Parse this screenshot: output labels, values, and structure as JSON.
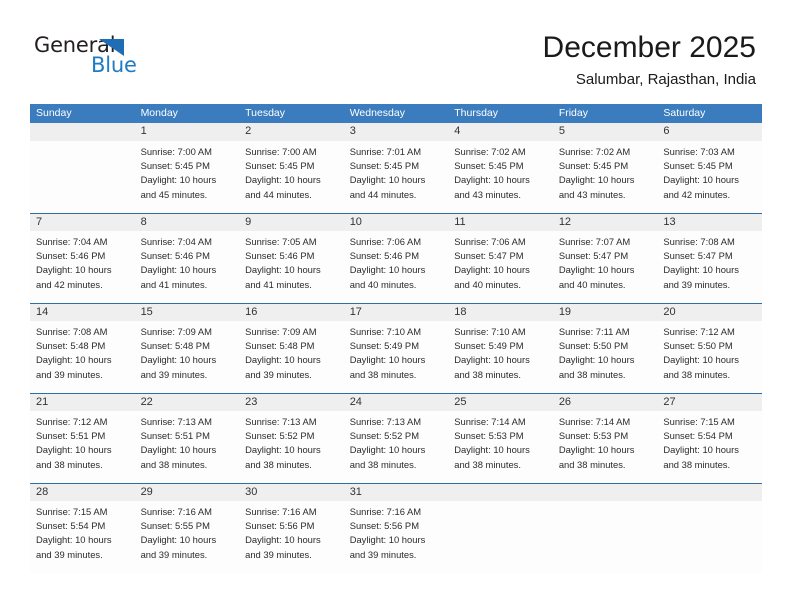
{
  "brand": {
    "name_part1": "General",
    "name_part2": "Blue",
    "triangle_icon": "triangle-icon",
    "accent_color": "#1f7cc4"
  },
  "header": {
    "title": "December 2025",
    "location": "Salumbar, Rajasthan, India"
  },
  "colors": {
    "header_blue": "#3a7cbe",
    "row_separator_blue": "#2e6da4",
    "daynum_band": "#efefef"
  },
  "calendar": {
    "weekday_headers": [
      "Sunday",
      "Monday",
      "Tuesday",
      "Wednesday",
      "Thursday",
      "Friday",
      "Saturday"
    ],
    "weeks": [
      [
        {
          "day": "",
          "sunrise": "",
          "sunset": "",
          "daylight_line1": "",
          "daylight_line2": ""
        },
        {
          "day": "1",
          "sunrise": "Sunrise: 7:00 AM",
          "sunset": "Sunset: 5:45 PM",
          "daylight_line1": "Daylight: 10 hours",
          "daylight_line2": "and 45 minutes."
        },
        {
          "day": "2",
          "sunrise": "Sunrise: 7:00 AM",
          "sunset": "Sunset: 5:45 PM",
          "daylight_line1": "Daylight: 10 hours",
          "daylight_line2": "and 44 minutes."
        },
        {
          "day": "3",
          "sunrise": "Sunrise: 7:01 AM",
          "sunset": "Sunset: 5:45 PM",
          "daylight_line1": "Daylight: 10 hours",
          "daylight_line2": "and 44 minutes."
        },
        {
          "day": "4",
          "sunrise": "Sunrise: 7:02 AM",
          "sunset": "Sunset: 5:45 PM",
          "daylight_line1": "Daylight: 10 hours",
          "daylight_line2": "and 43 minutes."
        },
        {
          "day": "5",
          "sunrise": "Sunrise: 7:02 AM",
          "sunset": "Sunset: 5:45 PM",
          "daylight_line1": "Daylight: 10 hours",
          "daylight_line2": "and 43 minutes."
        },
        {
          "day": "6",
          "sunrise": "Sunrise: 7:03 AM",
          "sunset": "Sunset: 5:45 PM",
          "daylight_line1": "Daylight: 10 hours",
          "daylight_line2": "and 42 minutes."
        }
      ],
      [
        {
          "day": "7",
          "sunrise": "Sunrise: 7:04 AM",
          "sunset": "Sunset: 5:46 PM",
          "daylight_line1": "Daylight: 10 hours",
          "daylight_line2": "and 42 minutes."
        },
        {
          "day": "8",
          "sunrise": "Sunrise: 7:04 AM",
          "sunset": "Sunset: 5:46 PM",
          "daylight_line1": "Daylight: 10 hours",
          "daylight_line2": "and 41 minutes."
        },
        {
          "day": "9",
          "sunrise": "Sunrise: 7:05 AM",
          "sunset": "Sunset: 5:46 PM",
          "daylight_line1": "Daylight: 10 hours",
          "daylight_line2": "and 41 minutes."
        },
        {
          "day": "10",
          "sunrise": "Sunrise: 7:06 AM",
          "sunset": "Sunset: 5:46 PM",
          "daylight_line1": "Daylight: 10 hours",
          "daylight_line2": "and 40 minutes."
        },
        {
          "day": "11",
          "sunrise": "Sunrise: 7:06 AM",
          "sunset": "Sunset: 5:47 PM",
          "daylight_line1": "Daylight: 10 hours",
          "daylight_line2": "and 40 minutes."
        },
        {
          "day": "12",
          "sunrise": "Sunrise: 7:07 AM",
          "sunset": "Sunset: 5:47 PM",
          "daylight_line1": "Daylight: 10 hours",
          "daylight_line2": "and 40 minutes."
        },
        {
          "day": "13",
          "sunrise": "Sunrise: 7:08 AM",
          "sunset": "Sunset: 5:47 PM",
          "daylight_line1": "Daylight: 10 hours",
          "daylight_line2": "and 39 minutes."
        }
      ],
      [
        {
          "day": "14",
          "sunrise": "Sunrise: 7:08 AM",
          "sunset": "Sunset: 5:48 PM",
          "daylight_line1": "Daylight: 10 hours",
          "daylight_line2": "and 39 minutes."
        },
        {
          "day": "15",
          "sunrise": "Sunrise: 7:09 AM",
          "sunset": "Sunset: 5:48 PM",
          "daylight_line1": "Daylight: 10 hours",
          "daylight_line2": "and 39 minutes."
        },
        {
          "day": "16",
          "sunrise": "Sunrise: 7:09 AM",
          "sunset": "Sunset: 5:48 PM",
          "daylight_line1": "Daylight: 10 hours",
          "daylight_line2": "and 39 minutes."
        },
        {
          "day": "17",
          "sunrise": "Sunrise: 7:10 AM",
          "sunset": "Sunset: 5:49 PM",
          "daylight_line1": "Daylight: 10 hours",
          "daylight_line2": "and 38 minutes."
        },
        {
          "day": "18",
          "sunrise": "Sunrise: 7:10 AM",
          "sunset": "Sunset: 5:49 PM",
          "daylight_line1": "Daylight: 10 hours",
          "daylight_line2": "and 38 minutes."
        },
        {
          "day": "19",
          "sunrise": "Sunrise: 7:11 AM",
          "sunset": "Sunset: 5:50 PM",
          "daylight_line1": "Daylight: 10 hours",
          "daylight_line2": "and 38 minutes."
        },
        {
          "day": "20",
          "sunrise": "Sunrise: 7:12 AM",
          "sunset": "Sunset: 5:50 PM",
          "daylight_line1": "Daylight: 10 hours",
          "daylight_line2": "and 38 minutes."
        }
      ],
      [
        {
          "day": "21",
          "sunrise": "Sunrise: 7:12 AM",
          "sunset": "Sunset: 5:51 PM",
          "daylight_line1": "Daylight: 10 hours",
          "daylight_line2": "and 38 minutes."
        },
        {
          "day": "22",
          "sunrise": "Sunrise: 7:13 AM",
          "sunset": "Sunset: 5:51 PM",
          "daylight_line1": "Daylight: 10 hours",
          "daylight_line2": "and 38 minutes."
        },
        {
          "day": "23",
          "sunrise": "Sunrise: 7:13 AM",
          "sunset": "Sunset: 5:52 PM",
          "daylight_line1": "Daylight: 10 hours",
          "daylight_line2": "and 38 minutes."
        },
        {
          "day": "24",
          "sunrise": "Sunrise: 7:13 AM",
          "sunset": "Sunset: 5:52 PM",
          "daylight_line1": "Daylight: 10 hours",
          "daylight_line2": "and 38 minutes."
        },
        {
          "day": "25",
          "sunrise": "Sunrise: 7:14 AM",
          "sunset": "Sunset: 5:53 PM",
          "daylight_line1": "Daylight: 10 hours",
          "daylight_line2": "and 38 minutes."
        },
        {
          "day": "26",
          "sunrise": "Sunrise: 7:14 AM",
          "sunset": "Sunset: 5:53 PM",
          "daylight_line1": "Daylight: 10 hours",
          "daylight_line2": "and 38 minutes."
        },
        {
          "day": "27",
          "sunrise": "Sunrise: 7:15 AM",
          "sunset": "Sunset: 5:54 PM",
          "daylight_line1": "Daylight: 10 hours",
          "daylight_line2": "and 38 minutes."
        }
      ],
      [
        {
          "day": "28",
          "sunrise": "Sunrise: 7:15 AM",
          "sunset": "Sunset: 5:54 PM",
          "daylight_line1": "Daylight: 10 hours",
          "daylight_line2": "and 39 minutes."
        },
        {
          "day": "29",
          "sunrise": "Sunrise: 7:16 AM",
          "sunset": "Sunset: 5:55 PM",
          "daylight_line1": "Daylight: 10 hours",
          "daylight_line2": "and 39 minutes."
        },
        {
          "day": "30",
          "sunrise": "Sunrise: 7:16 AM",
          "sunset": "Sunset: 5:56 PM",
          "daylight_line1": "Daylight: 10 hours",
          "daylight_line2": "and 39 minutes."
        },
        {
          "day": "31",
          "sunrise": "Sunrise: 7:16 AM",
          "sunset": "Sunset: 5:56 PM",
          "daylight_line1": "Daylight: 10 hours",
          "daylight_line2": "and 39 minutes."
        },
        {
          "day": "",
          "sunrise": "",
          "sunset": "",
          "daylight_line1": "",
          "daylight_line2": ""
        },
        {
          "day": "",
          "sunrise": "",
          "sunset": "",
          "daylight_line1": "",
          "daylight_line2": ""
        },
        {
          "day": "",
          "sunrise": "",
          "sunset": "",
          "daylight_line1": "",
          "daylight_line2": ""
        }
      ]
    ]
  }
}
